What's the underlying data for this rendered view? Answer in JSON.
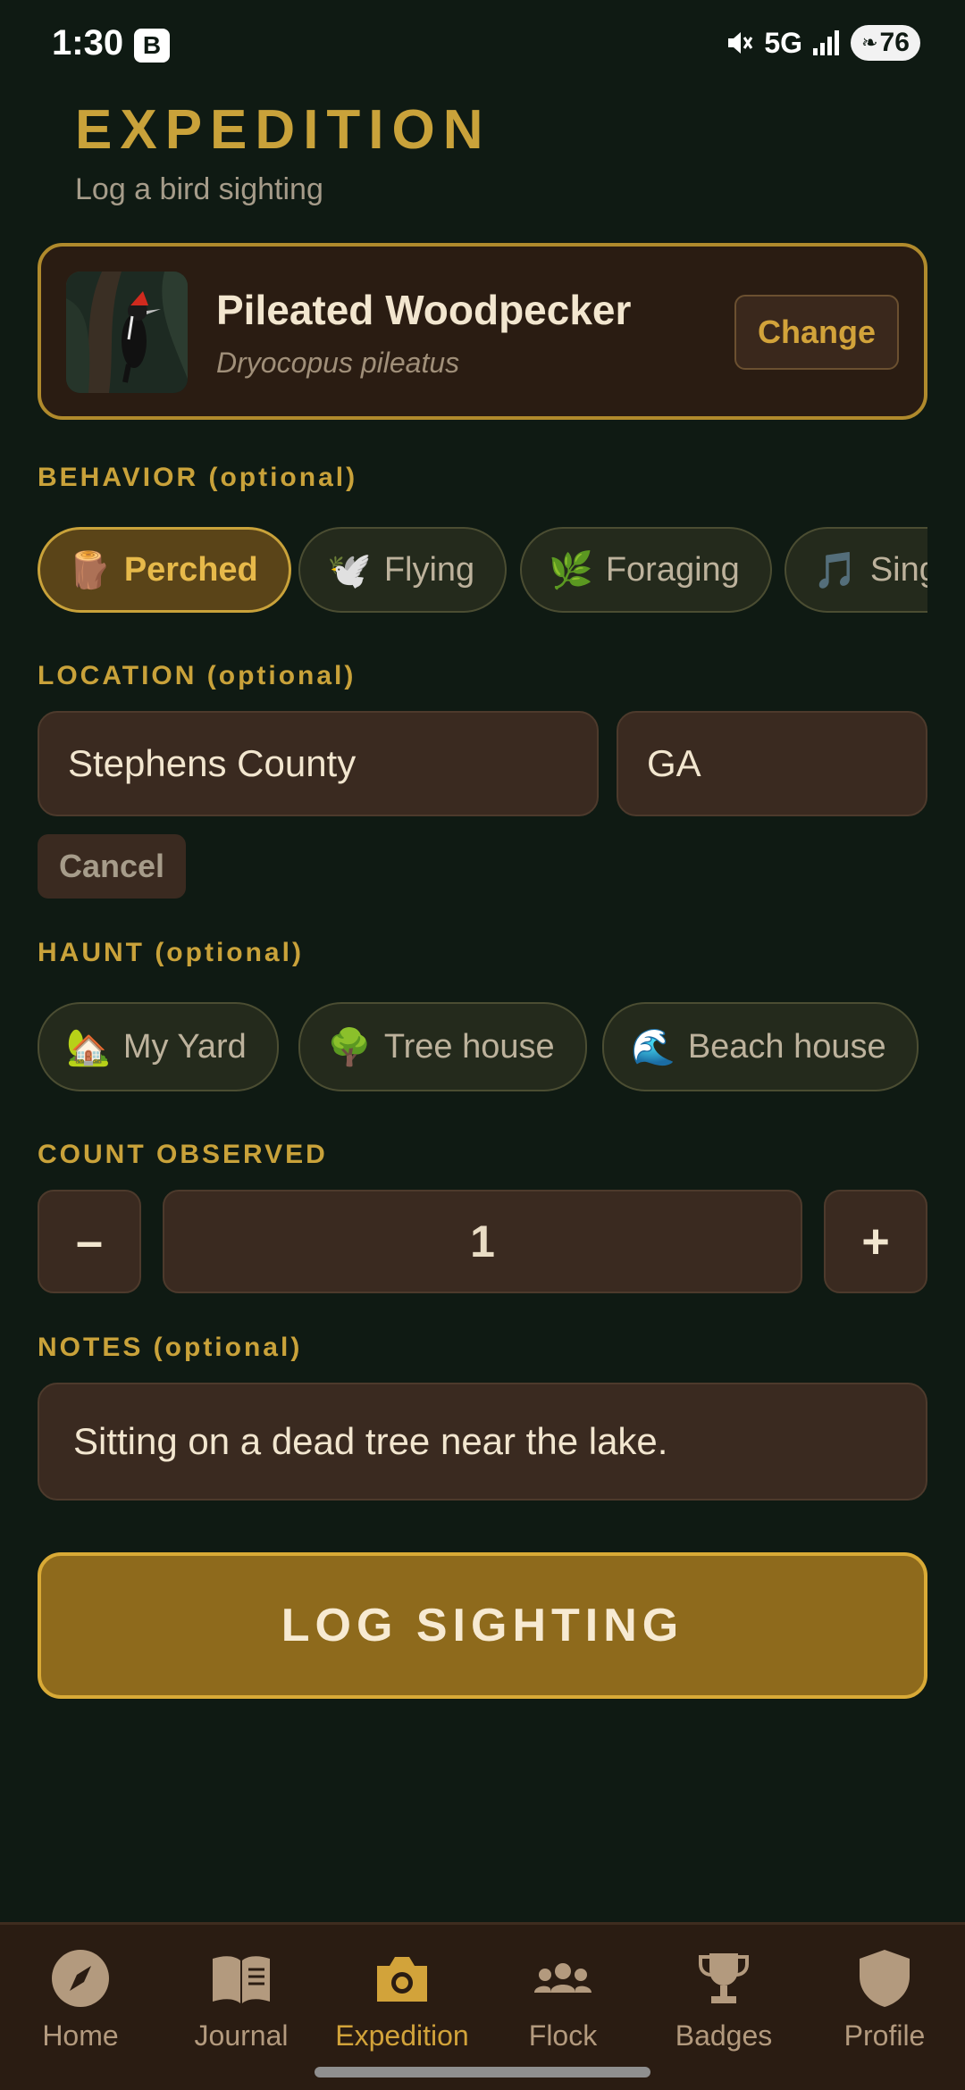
{
  "status_bar": {
    "time": "1:30",
    "b_badge": "B",
    "network": "5G",
    "battery": "76",
    "icons": [
      "mute-icon",
      "signal-icon",
      "battery-icon"
    ]
  },
  "header": {
    "title": "EXPEDITION",
    "subtitle": "Log a bird sighting"
  },
  "species": {
    "name": "Pileated Woodpecker",
    "latin": "Dryocopus pileatus",
    "change_label": "Change"
  },
  "behavior": {
    "label": "BEHAVIOR (optional)",
    "chips": [
      {
        "emoji": "🪵",
        "label": "Perched",
        "selected": true
      },
      {
        "emoji": "🕊️",
        "label": "Flying",
        "selected": false
      },
      {
        "emoji": "🌿",
        "label": "Foraging",
        "selected": false
      },
      {
        "emoji": "🎵",
        "label": "Singing",
        "selected": false
      }
    ]
  },
  "location": {
    "label": "LOCATION (optional)",
    "county": "Stephens County",
    "state": "GA",
    "cancel_label": "Cancel"
  },
  "haunt": {
    "label": "HAUNT (optional)",
    "chips": [
      {
        "emoji": "🏡",
        "label": "My Yard"
      },
      {
        "emoji": "🌳",
        "label": "Tree house"
      },
      {
        "emoji": "🌊",
        "label": "Beach house"
      }
    ]
  },
  "count": {
    "label": "COUNT OBSERVED",
    "minus": "–",
    "value": "1",
    "plus": "+"
  },
  "notes": {
    "label": "NOTES (optional)",
    "value": "Sitting on a dead tree near the lake."
  },
  "submit_label": "LOG SIGHTING",
  "nav": {
    "items": [
      {
        "label": "Home",
        "icon": "compass-icon"
      },
      {
        "label": "Journal",
        "icon": "book-icon"
      },
      {
        "label": "Expedition",
        "icon": "camera-icon",
        "active": true
      },
      {
        "label": "Flock",
        "icon": "people-icon"
      },
      {
        "label": "Badges",
        "icon": "trophy-icon"
      },
      {
        "label": "Profile",
        "icon": "shield-icon"
      }
    ]
  },
  "colors": {
    "background": "#0f1a13",
    "accent": "#c9a23a",
    "card": "#2a1c12",
    "field": "#3a2a20"
  }
}
